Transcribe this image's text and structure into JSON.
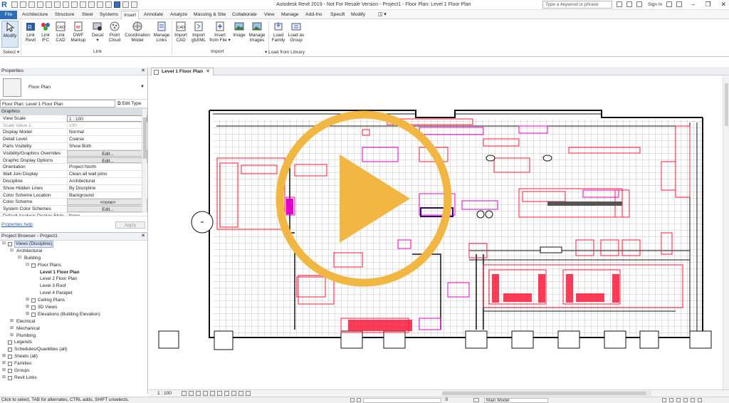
{
  "app": {
    "title": "Autodesk Revit 2019 - Not For Resale Version - Project1 - Floor Plan: Level 1 Floor Plan",
    "logo": "R",
    "search_placeholder": "Type a keyword or phrase",
    "sign_in": "Sign In"
  },
  "ribbon_tabs": [
    {
      "label": "File"
    },
    {
      "label": "Architecture"
    },
    {
      "label": "Structure"
    },
    {
      "label": "Steel"
    },
    {
      "label": "Systems"
    },
    {
      "label": "Insert"
    },
    {
      "label": "Annotate"
    },
    {
      "label": "Analyze"
    },
    {
      "label": "Massing & Site"
    },
    {
      "label": "Collaborate"
    },
    {
      "label": "View"
    },
    {
      "label": "Manage"
    },
    {
      "label": "Add-Ins"
    },
    {
      "label": "Specifi"
    },
    {
      "label": "Modify"
    }
  ],
  "ribbon": {
    "modify": {
      "line1": "Modify",
      "line2": ""
    },
    "select_label": "Select ▾",
    "buttons": [
      {
        "line1": "Link",
        "line2": "Revit"
      },
      {
        "line1": "Link",
        "line2": "IFC"
      },
      {
        "line1": "Link",
        "line2": "CAD"
      },
      {
        "line1": "DWF",
        "line2": "Markup"
      },
      {
        "line1": "Decal",
        "line2": "▾"
      },
      {
        "line1": "Point",
        "line2": "Cloud"
      },
      {
        "line1": "Coordination",
        "line2": "Model"
      },
      {
        "line1": "Manage",
        "line2": "Links"
      },
      {
        "line1": "Import",
        "line2": "CAD"
      },
      {
        "line1": "Import",
        "line2": "gbXML"
      },
      {
        "line1": "Insert",
        "line2": "from File ▾"
      },
      {
        "line1": "Image",
        "line2": ""
      },
      {
        "line1": "Manage",
        "line2": "Images"
      },
      {
        "line1": "Load",
        "line2": "Family"
      },
      {
        "line1": "Load as",
        "line2": "Group"
      }
    ],
    "groups": {
      "link": "Link",
      "import": "Import",
      "load_from_library": "Load from Library"
    }
  },
  "properties": {
    "header": "Properties",
    "type_name": "Floor Plan",
    "instance": "Floor Plan: Level 1 Floor Plan",
    "edit_type": "Edit Type",
    "section": "Graphics",
    "rows": [
      {
        "key": "View Scale",
        "value": "1 : 100"
      },
      {
        "key": "Scale Value    1:",
        "value": "100"
      },
      {
        "key": "Display Model",
        "value": "Normal"
      },
      {
        "key": "Detail Level",
        "value": "Coarse"
      },
      {
        "key": "Parts Visibility",
        "value": "Show Both"
      },
      {
        "key": "Visibility/Graphics Overrides",
        "value": "Edit..."
      },
      {
        "key": "Graphic Display Options",
        "value": "Edit..."
      },
      {
        "key": "Orientation",
        "value": "Project North"
      },
      {
        "key": "Wall Join Display",
        "value": "Clean all wall joins"
      },
      {
        "key": "Discipline",
        "value": "Architectural"
      },
      {
        "key": "Show Hidden Lines",
        "value": "By Discipline"
      },
      {
        "key": "Color Scheme Location",
        "value": "Background"
      },
      {
        "key": "Color Scheme",
        "value": "<none>"
      },
      {
        "key": "System Color Schemes",
        "value": "Edit..."
      },
      {
        "key": "Default Analysis Display Style",
        "value": "None"
      }
    ],
    "help_link": "Properties help",
    "apply": "Apply"
  },
  "project_browser": {
    "header": "Project Browser - Project1",
    "nodes": [
      {
        "label": "Views (Discipline)",
        "level": 0,
        "exp": "⊟"
      },
      {
        "label": "Architectural",
        "level": 1,
        "exp": "⊟"
      },
      {
        "label": "Building",
        "level": 2,
        "exp": "⊟"
      },
      {
        "label": "Floor Plans",
        "level": 3,
        "exp": "⊟"
      },
      {
        "label": "Level 1 Floor Plan",
        "level": 4,
        "exp": ""
      },
      {
        "label": "Level 2 Floor Plan",
        "level": 4,
        "exp": ""
      },
      {
        "label": "Level 3 Roof",
        "level": 4,
        "exp": ""
      },
      {
        "label": "Level 4 Parapet",
        "level": 4,
        "exp": ""
      },
      {
        "label": "Ceiling Plans",
        "level": 3,
        "exp": "⊞"
      },
      {
        "label": "3D Views",
        "level": 3,
        "exp": "⊞"
      },
      {
        "label": "Elevations (Building Elevation)",
        "level": 3,
        "exp": "⊞"
      },
      {
        "label": "Electrical",
        "level": 1,
        "exp": "⊞"
      },
      {
        "label": "Mechanical",
        "level": 1,
        "exp": "⊞"
      },
      {
        "label": "Plumbing",
        "level": 1,
        "exp": "⊞"
      },
      {
        "label": "Legends",
        "level": 0,
        "exp": ""
      },
      {
        "label": "Schedules/Quantities (all)",
        "level": 0,
        "exp": ""
      },
      {
        "label": "Sheets (all)",
        "level": 0,
        "exp": "⊞"
      },
      {
        "label": "Families",
        "level": 0,
        "exp": "⊞"
      },
      {
        "label": "Groups",
        "level": 0,
        "exp": "⊞"
      },
      {
        "label": "Revit Links",
        "level": 0,
        "exp": "⊞"
      }
    ]
  },
  "view_tab": {
    "label": "Level 1 Floor Plan",
    "close": "✕"
  },
  "view_control": {
    "scale": "1 : 100"
  },
  "status": {
    "message": "Click to select, TAB for alternates, CTRL adds, SHIFT unselects.",
    "workset": "Main Model",
    "count": ":0"
  },
  "colors": {
    "accent": "#2d6cb6",
    "play": "#f2b642",
    "drawing_red": "#ff1a3a",
    "drawing_magenta": "#e400c8"
  }
}
